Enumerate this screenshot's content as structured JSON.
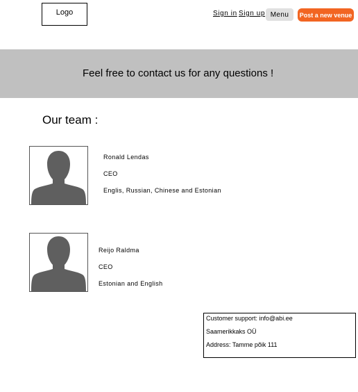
{
  "header": {
    "logo": "Logo",
    "sign_in": "Sign in",
    "sign_up": "Sign up",
    "menu": "Menu",
    "post_venue": "Post a new venue",
    "post_venue_color": "#f26522"
  },
  "banner": {
    "text": "Feel free to contact us for any questions !",
    "background": "#c0c0c0"
  },
  "team": {
    "heading": "Our team :",
    "members": [
      {
        "name": "Ronald Lendas",
        "role": "CEO",
        "languages": "Englis, Russian, Chinese and Estonian",
        "avatar_icon": "person-silhouette-icon"
      },
      {
        "name": "Reijo Raldma",
        "role": "CEO",
        "languages": "Estonian and English",
        "avatar_icon": "person-silhouette-icon"
      }
    ]
  },
  "footer": {
    "support": "Customer support: info@abi.ee",
    "company": "Saamerikkaks OÜ",
    "address": "Address: Tamme põik 111"
  }
}
